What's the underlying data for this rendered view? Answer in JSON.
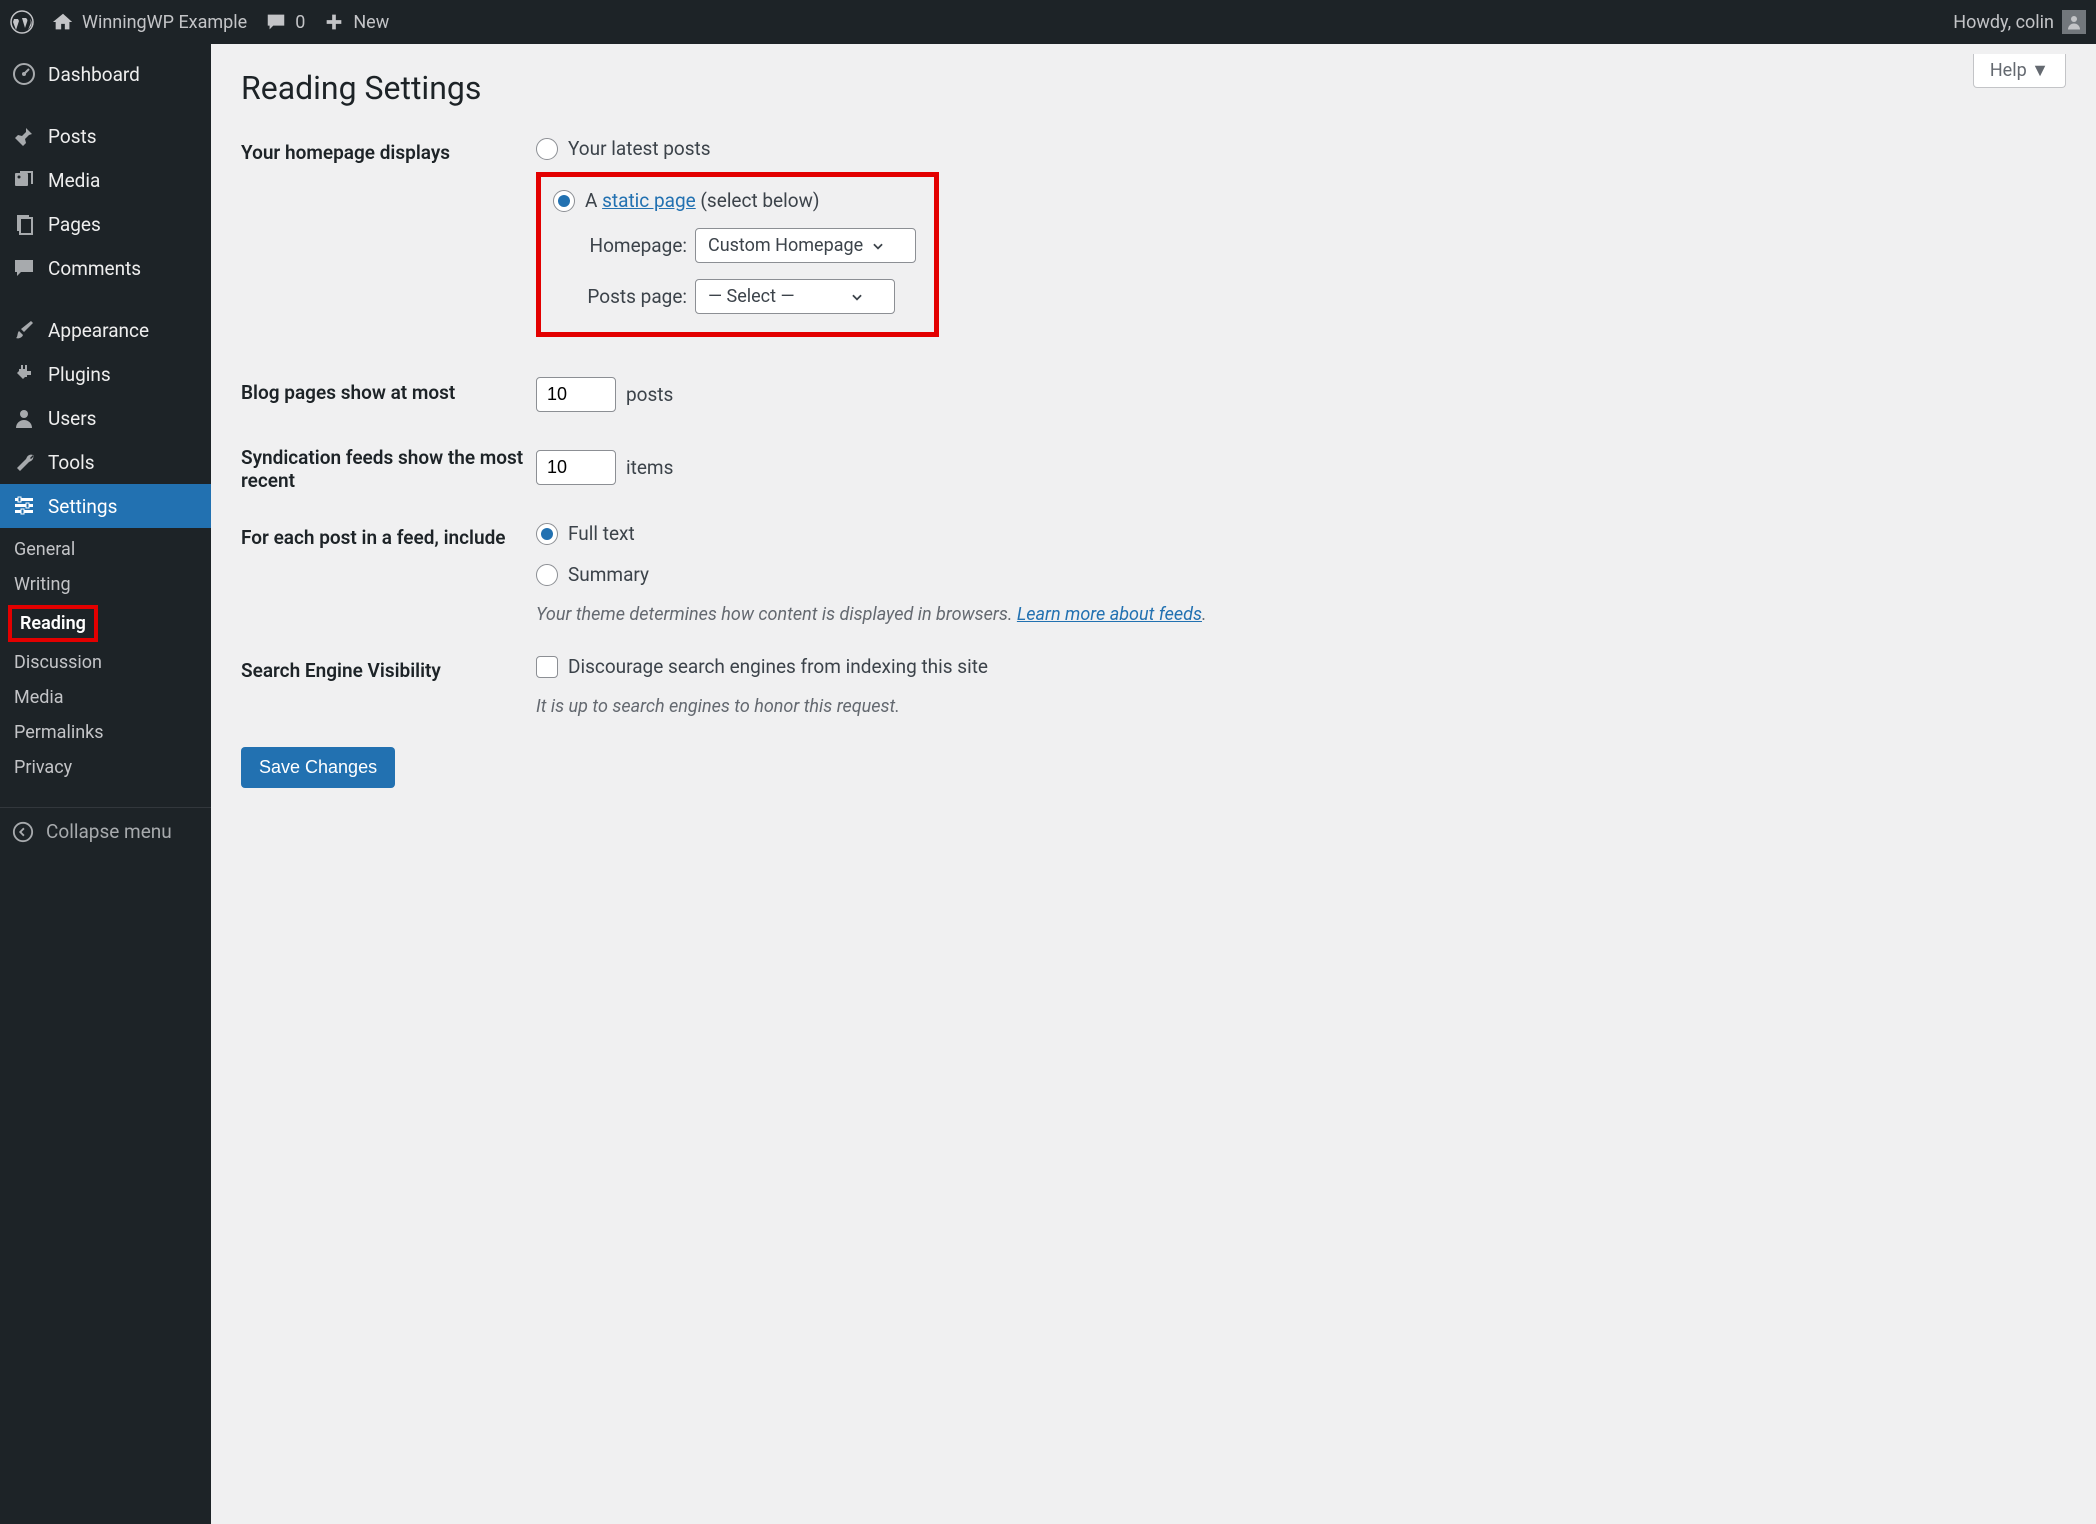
{
  "adminbar": {
    "site_name": "WinningWP Example",
    "comments_count": "0",
    "new_label": "New",
    "howdy": "Howdy, colin"
  },
  "sidebar": {
    "items": [
      {
        "label": "Dashboard"
      },
      {
        "label": "Posts"
      },
      {
        "label": "Media"
      },
      {
        "label": "Pages"
      },
      {
        "label": "Comments"
      },
      {
        "label": "Appearance"
      },
      {
        "label": "Plugins"
      },
      {
        "label": "Users"
      },
      {
        "label": "Tools"
      },
      {
        "label": "Settings"
      }
    ],
    "submenu": [
      {
        "label": "General"
      },
      {
        "label": "Writing"
      },
      {
        "label": "Reading"
      },
      {
        "label": "Discussion"
      },
      {
        "label": "Media"
      },
      {
        "label": "Permalinks"
      },
      {
        "label": "Privacy"
      }
    ],
    "collapse": "Collapse menu"
  },
  "content": {
    "help": "Help",
    "title": "Reading Settings",
    "homepage": {
      "label": "Your homepage displays",
      "opt_latest": "Your latest posts",
      "opt_static_a": "A ",
      "opt_static_link": "static page",
      "opt_static_after": " (select below)",
      "homepage_label": "Homepage:",
      "homepage_value": "Custom Homepage",
      "posts_label": "Posts page:",
      "posts_value": "— Select —"
    },
    "blog_pages": {
      "label": "Blog pages show at most",
      "value": "10",
      "suffix": "posts"
    },
    "syndication": {
      "label": "Syndication feeds show the most recent",
      "value": "10",
      "suffix": "items"
    },
    "feed": {
      "label": "For each post in a feed, include",
      "opt_full": "Full text",
      "opt_summary": "Summary",
      "desc_pre": "Your theme determines how content is displayed in browsers. ",
      "desc_link": "Learn more about feeds"
    },
    "search": {
      "label": "Search Engine Visibility",
      "checkbox_label": "Discourage search engines from indexing this site",
      "desc": "It is up to search engines to honor this request."
    },
    "save": "Save Changes"
  }
}
